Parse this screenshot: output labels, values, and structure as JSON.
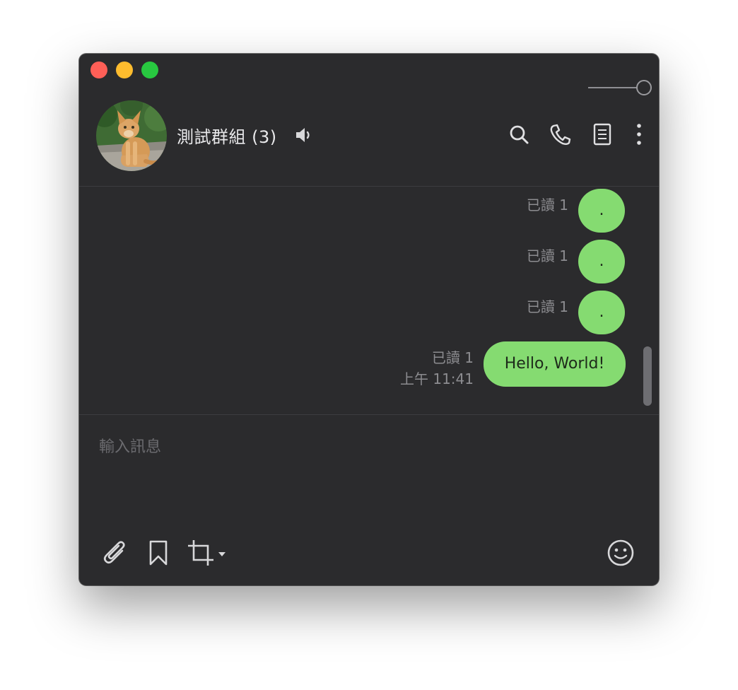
{
  "window": {
    "controls": [
      "close-button",
      "minimize-button",
      "maximize-button"
    ]
  },
  "header": {
    "title": "測試群組 (3)",
    "actions": [
      "search-icon",
      "phone-icon",
      "notes-icon",
      "more-icon"
    ]
  },
  "messages": [
    {
      "text": ".",
      "read": "已讀 1"
    },
    {
      "text": ".",
      "read": "已讀 1"
    },
    {
      "text": ".",
      "read": "已讀 1"
    },
    {
      "text": "Hello, World!",
      "read": "已讀 1",
      "time": "上午 11:41"
    }
  ],
  "input": {
    "placeholder": "輸入訊息"
  },
  "toolbar": {
    "icons": [
      "paperclip-icon",
      "bookmark-icon",
      "crop-icon",
      "emoji-icon"
    ]
  },
  "colors": {
    "window_bg": "#2b2b2d",
    "bubble": "#85db71",
    "close": "#fe5f57",
    "minimize": "#febc2e",
    "maximize": "#28c840"
  }
}
